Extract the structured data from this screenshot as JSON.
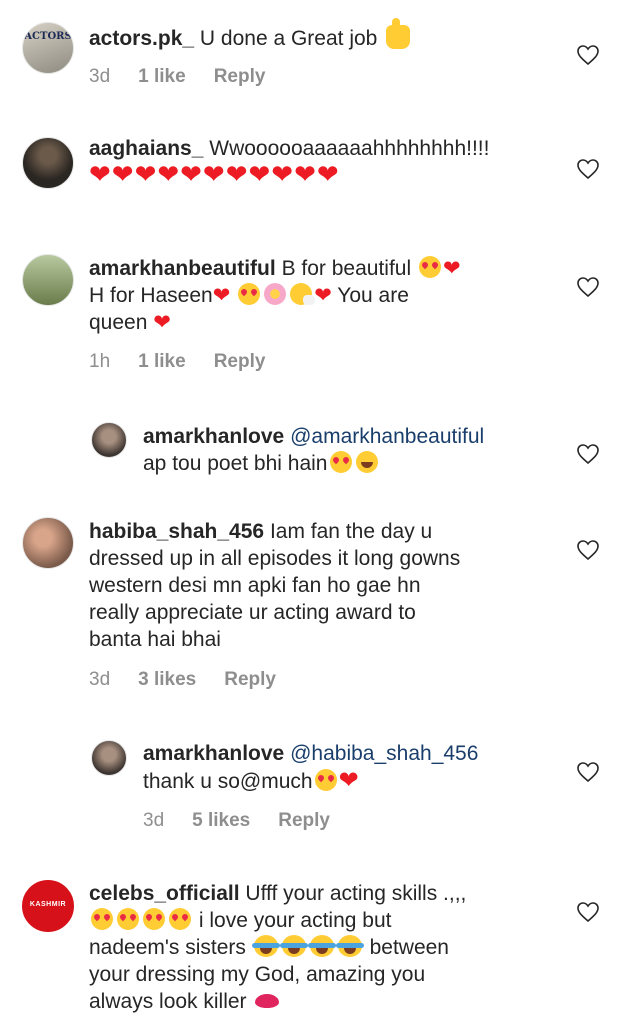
{
  "comments": [
    {
      "username": "actors.pk_",
      "text": "U done a Great job",
      "time": "3d",
      "likes": "1 like",
      "reply": "Reply"
    },
    {
      "username": "aaghaians_",
      "text": "Wwoooooaaaaaahhhhhhhh!!!!"
    },
    {
      "username": "amarkhanbeautiful",
      "text_1": "B for beautiful",
      "text_2": "H for Haseen",
      "text_3": "You are",
      "text_4": "queen",
      "time": "1h",
      "likes": "1 like",
      "reply": "Reply"
    },
    {
      "username": "amarkhanlove",
      "mention": "@amarkhanbeautiful",
      "text": "ap tou poet bhi hain"
    },
    {
      "username": "habiba_shah_456",
      "text_1": "Iam fan the day u",
      "text_2": "dressed up in all episodes it long gowns",
      "text_3": "western desi mn apki fan ho gae hn",
      "text_4": "really appreciate ur acting award to",
      "text_5": "banta hai bhai",
      "time": "3d",
      "likes": "3 likes",
      "reply": "Reply"
    },
    {
      "username": "amarkhanlove",
      "mention": "@habiba_shah_456",
      "text": "thank u so@much",
      "time": "3d",
      "likes": "5 likes",
      "reply": "Reply"
    },
    {
      "username": "celebs_officiall",
      "text_1": "Ufff your acting skills .,,,",
      "text_2": "i love your acting but",
      "text_3": "nadeem's sisters",
      "text_4": "between",
      "text_5": "your dressing my God, amazing you",
      "text_6": "always look killer",
      "avatar_text": "KASHMIR"
    }
  ],
  "avatar_text_actors": "ACTORS",
  "colors": {
    "heart": "#ed1c24",
    "meta": "#8e8e8e",
    "mention": "#1a3e6b"
  }
}
